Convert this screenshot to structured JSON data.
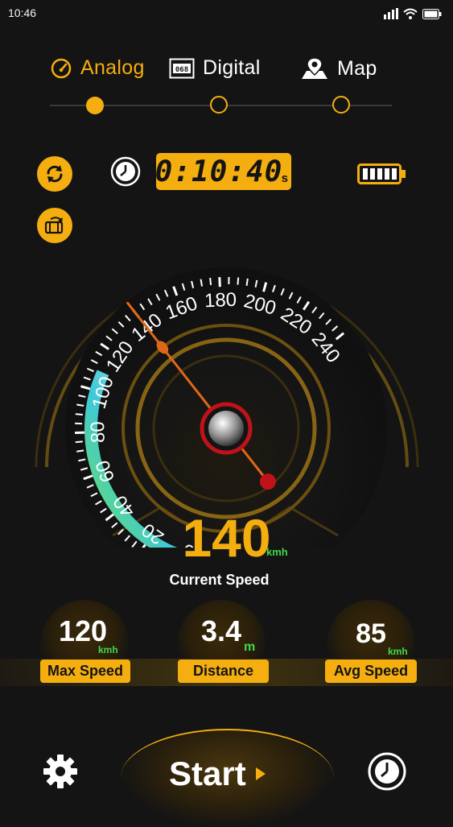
{
  "status_bar": {
    "time": "10:46"
  },
  "tabs": [
    {
      "label": "Analog",
      "icon": "speedometer-icon",
      "active": true
    },
    {
      "label": "Digital",
      "icon": "digital-display-icon",
      "active": false
    },
    {
      "label": "Map",
      "icon": "map-pin-icon",
      "active": false
    }
  ],
  "timer": {
    "value": "0:10:40",
    "unit": "s"
  },
  "gauge": {
    "ticks": [
      "0",
      "20",
      "40",
      "60",
      "80",
      "100",
      "120",
      "140",
      "160",
      "180",
      "200",
      "220",
      "240"
    ],
    "min": 0,
    "max": 240,
    "needle_value": 140
  },
  "speed": {
    "value": "140",
    "unit": "kmh",
    "label": "Current Speed"
  },
  "stats": [
    {
      "value": "120",
      "unit": "kmh",
      "label": "Max Speed"
    },
    {
      "value": "3.4",
      "unit": "m",
      "label": "Distance"
    },
    {
      "value": "85",
      "unit": "kmh",
      "label": "Avg Speed"
    }
  ],
  "bottom": {
    "start_label": "Start"
  },
  "colors": {
    "accent": "#f5ae10",
    "green": "#42d84a",
    "cyan": "#3ec8d8",
    "needle": "#e0671a"
  }
}
